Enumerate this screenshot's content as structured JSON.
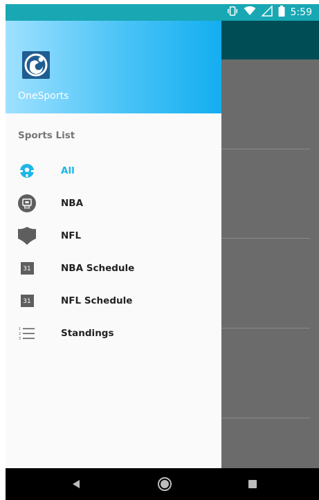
{
  "status_bar": {
    "time": "5:59",
    "icons": [
      "vibrate-icon",
      "wifi-icon",
      "signal-icon",
      "battery-icon"
    ]
  },
  "drawer": {
    "app_name": "OneSports",
    "section_title": "Sports List",
    "items": [
      {
        "label": "All",
        "icon": "soccer-ball-icon",
        "active": true
      },
      {
        "label": "NBA",
        "icon": "basketball-hoop-icon",
        "active": false
      },
      {
        "label": "NFL",
        "icon": "shield-icon",
        "active": false
      },
      {
        "label": "NBA Schedule",
        "icon": "calendar-icon",
        "calendar_day": "31",
        "active": false
      },
      {
        "label": "NFL Schedule",
        "icon": "calendar-icon",
        "calendar_day": "31",
        "active": false
      },
      {
        "label": "Standings",
        "icon": "numbered-list-icon",
        "active": false
      }
    ]
  },
  "nav_bar": {
    "buttons": [
      "back-icon",
      "home-icon",
      "recents-icon"
    ]
  },
  "colors": {
    "status_bar": "#18a7b3",
    "app_bar": "#004d56",
    "accent": "#1eb6e6",
    "scrim": "#6b6b6b",
    "drawer_bg": "#fafafa"
  }
}
